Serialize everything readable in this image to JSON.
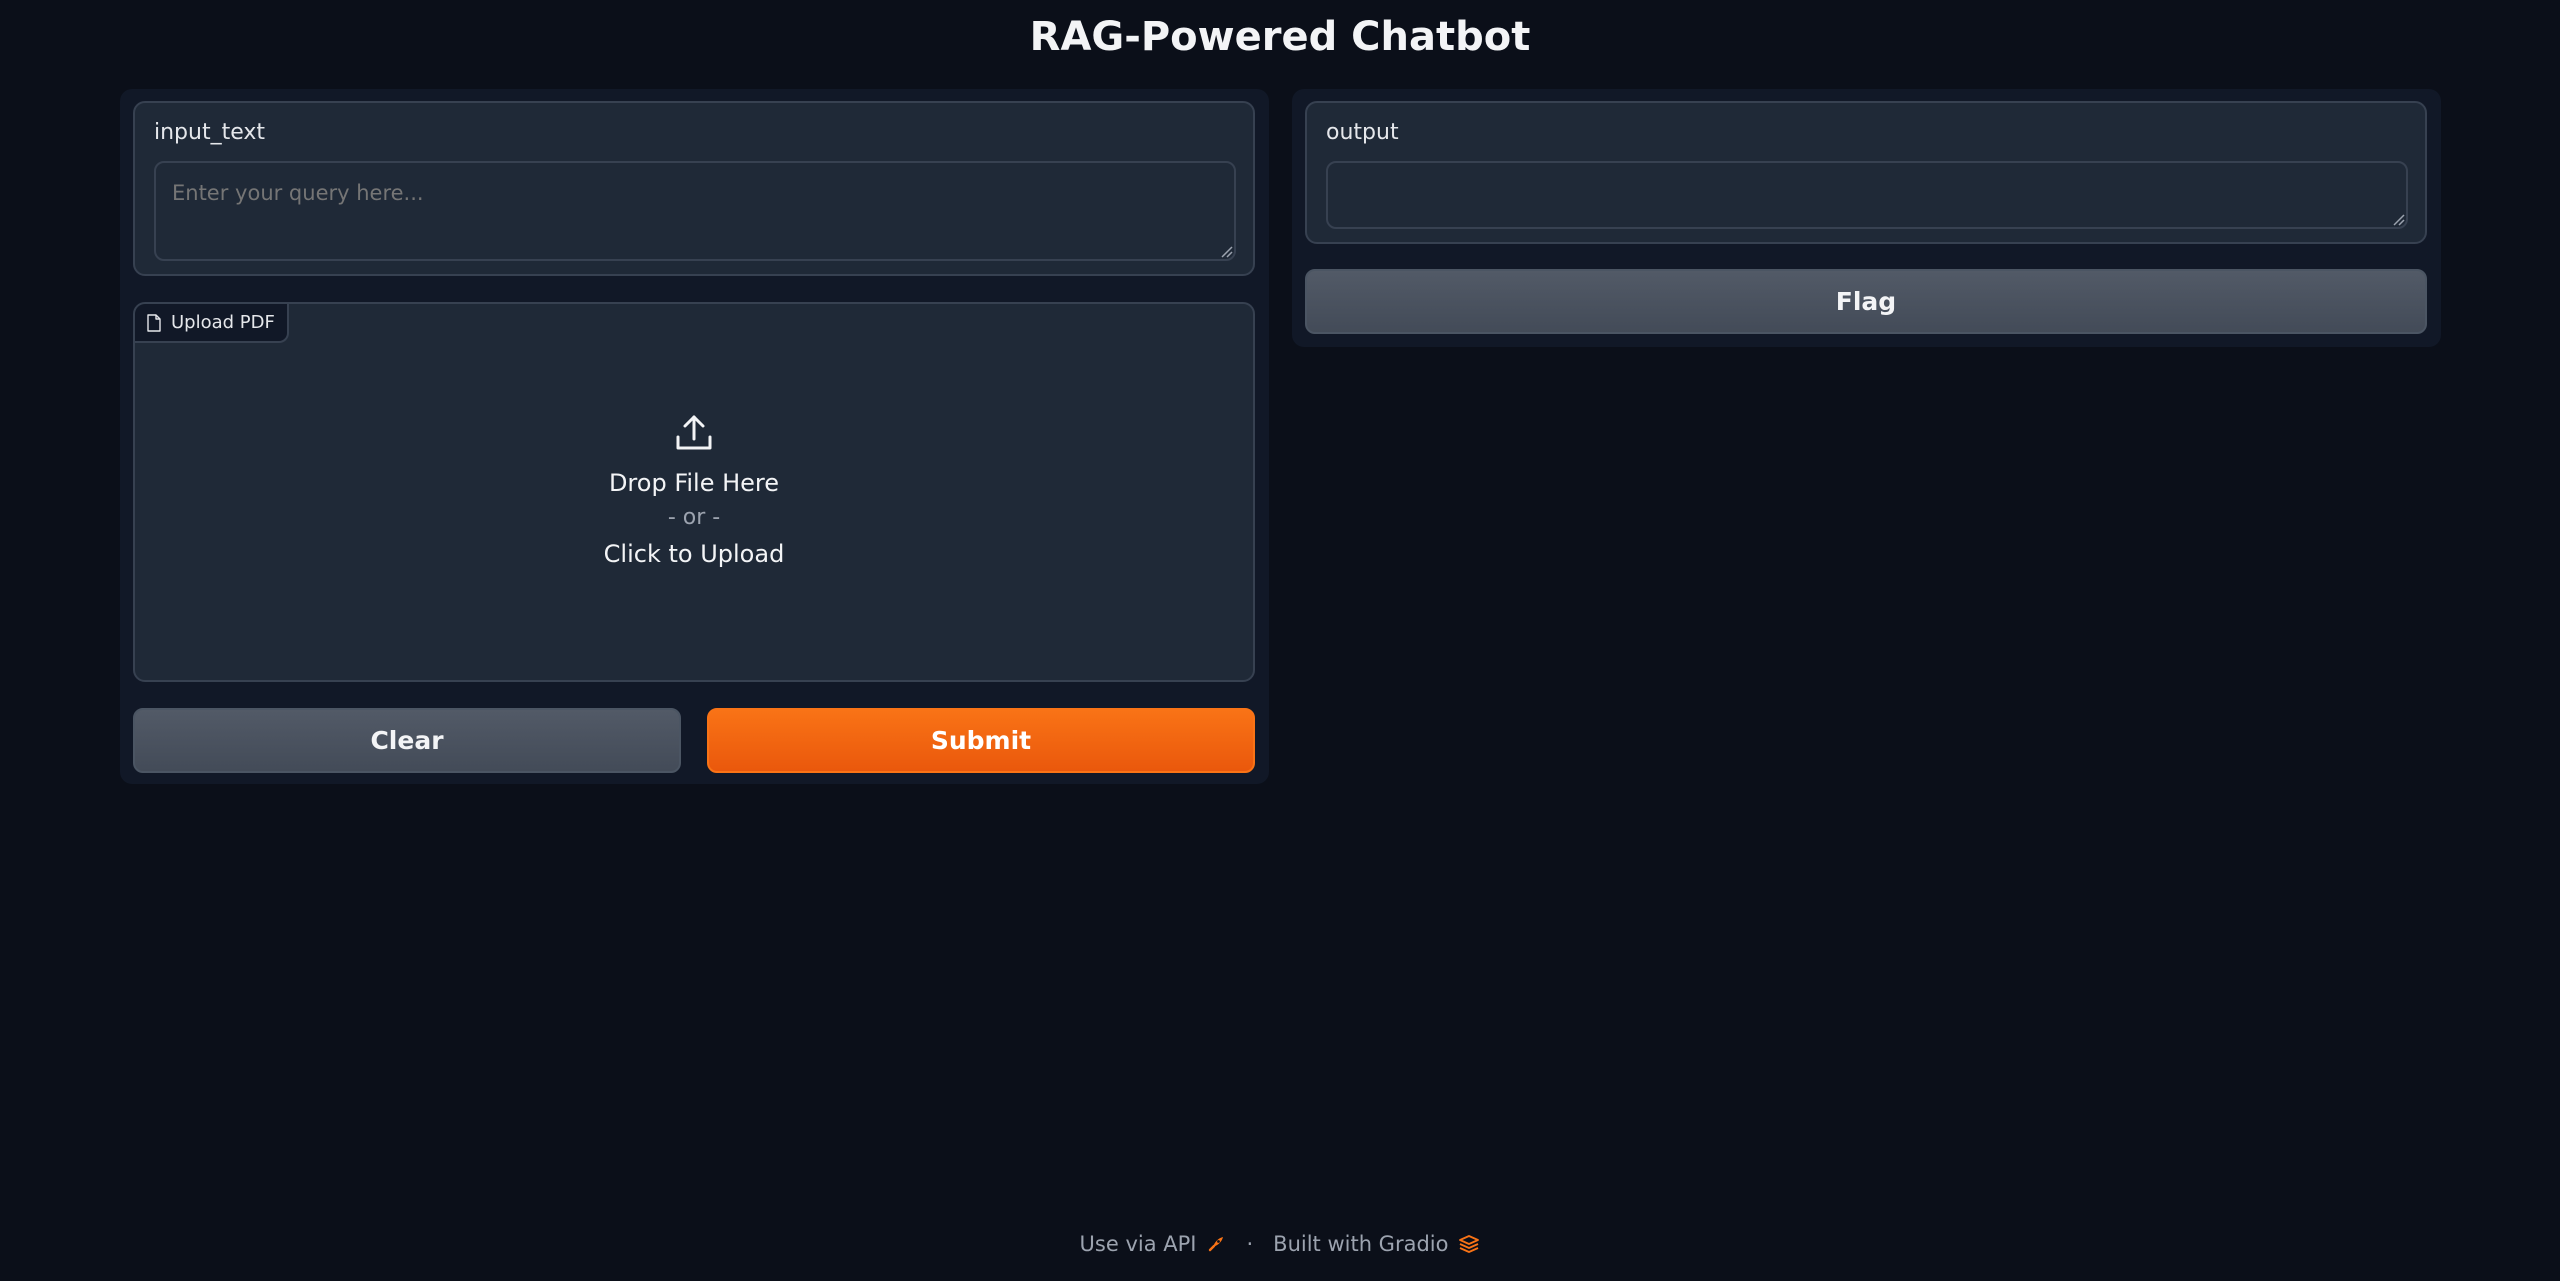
{
  "app": {
    "title": "RAG-Powered Chatbot"
  },
  "input_panel": {
    "label": "input_text",
    "placeholder": "Enter your query here...",
    "value": ""
  },
  "upload": {
    "tag_label": "Upload PDF",
    "drop_text": "Drop File Here",
    "or_text": "- or -",
    "click_text": "Click to Upload"
  },
  "buttons": {
    "clear": "Clear",
    "submit": "Submit",
    "flag": "Flag"
  },
  "output_panel": {
    "label": "output",
    "value": ""
  },
  "footer": {
    "api_link": "Use via API",
    "separator": "·",
    "built_with": "Built with Gradio"
  },
  "colors": {
    "background": "#0b0f19",
    "panel": "#111827",
    "block": "#1f2937",
    "accent": "#f97316"
  }
}
